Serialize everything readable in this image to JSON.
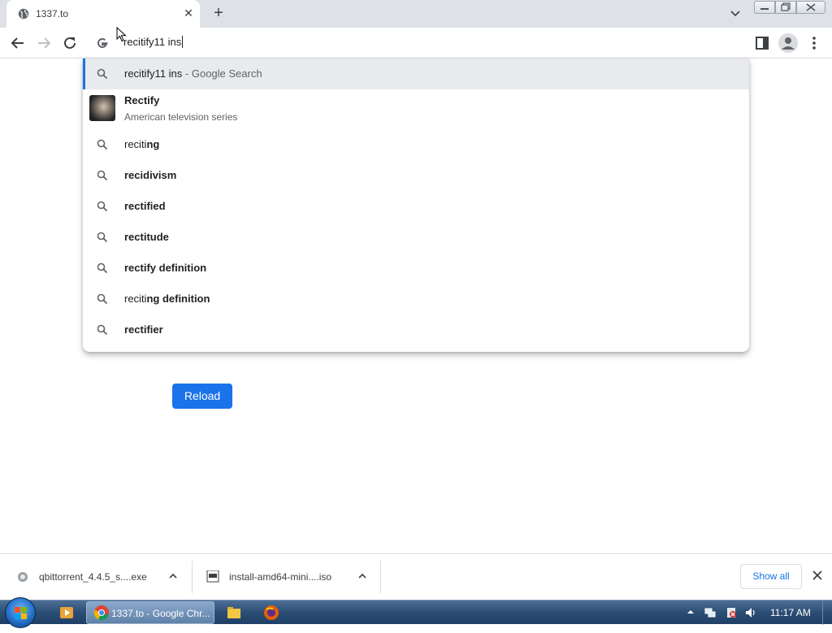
{
  "browser": {
    "tab": {
      "title": "1337.to",
      "close_label": "✕"
    },
    "new_tab_label": "+",
    "omnibox": {
      "value": "recitify11 ins"
    }
  },
  "suggestions": {
    "first": {
      "text": "recitify11 ins",
      "suffix": " - Google Search"
    },
    "entity": {
      "title": "Rectify",
      "subtitle": "American television series"
    },
    "items": [
      {
        "normal": "reciti",
        "bold": "ng"
      },
      {
        "normal": "",
        "bold": "recidivism"
      },
      {
        "normal": "",
        "bold": "rectified"
      },
      {
        "normal": "",
        "bold": "rectitude"
      },
      {
        "normal": "",
        "bold": "rectify definition"
      },
      {
        "normal": "reciti",
        "bold": "ng definition"
      },
      {
        "normal": "",
        "bold": "rectifier"
      }
    ]
  },
  "page": {
    "reload_label": "Reload"
  },
  "downloads": {
    "items": [
      {
        "name": "qbittorrent_4.4.5_s....exe",
        "icon": "installer-icon"
      },
      {
        "name": "install-amd64-mini....iso",
        "icon": "iso-file-icon"
      }
    ],
    "show_all_label": "Show all"
  },
  "taskbar": {
    "active_task_label": "1337.to - Google Chr...",
    "clock": "11:17 AM"
  },
  "colors": {
    "accent": "#1a73e8",
    "tabstrip": "#dee1e6",
    "selected_row": "#e8eaed",
    "taskbar": "#2d4e74"
  }
}
